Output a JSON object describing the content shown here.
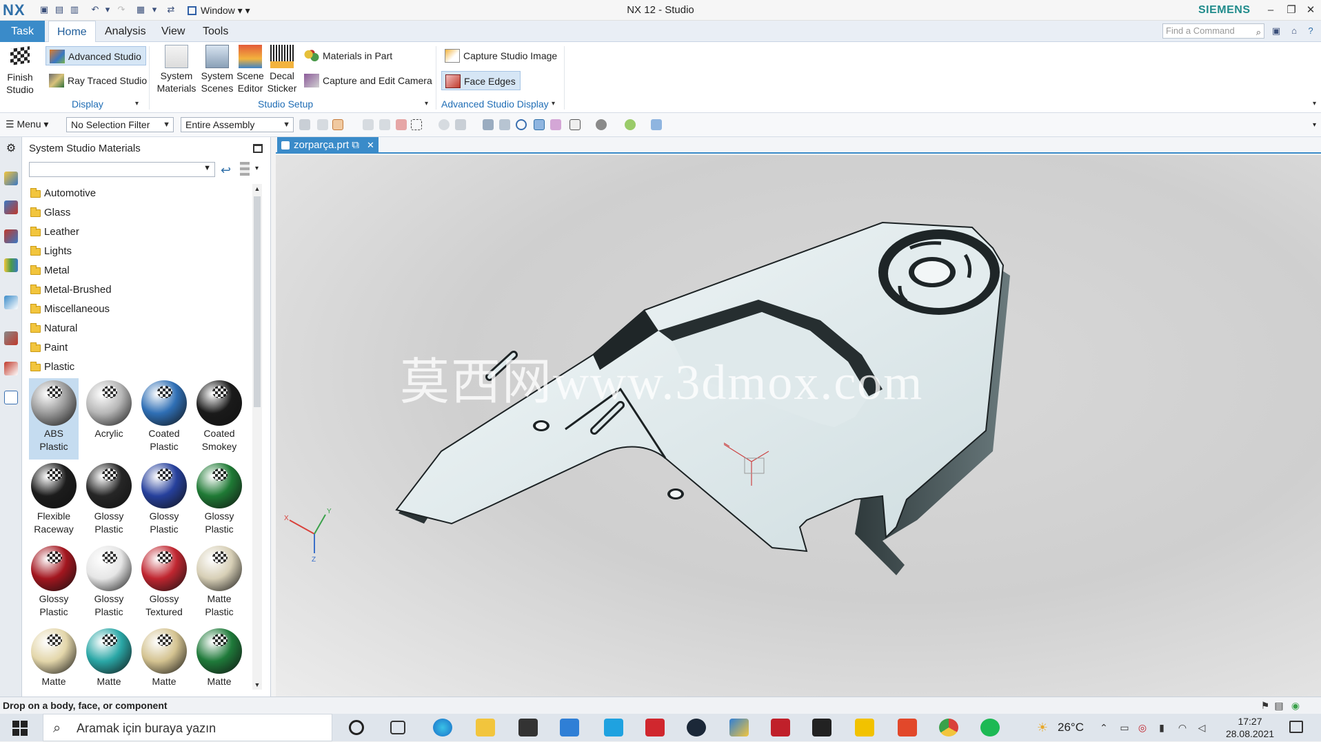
{
  "window": {
    "logo": "NX",
    "window_menu": "Window",
    "title": "NX 12 - Studio",
    "brand": "SIEMENS"
  },
  "tabs": {
    "task": "Task",
    "items": [
      "Home",
      "Analysis",
      "View",
      "Tools"
    ],
    "active": "Home",
    "find_placeholder": "Find a Command"
  },
  "ribbon": {
    "finish_studio": [
      "Finish",
      "Studio"
    ],
    "advanced_studio": "Advanced Studio",
    "ray_traced_studio": "Ray Traced Studio",
    "group_display": "Display",
    "system_materials": [
      "System",
      "Materials"
    ],
    "system_scenes": [
      "System",
      "Scenes"
    ],
    "scene_editor": [
      "Scene",
      "Editor"
    ],
    "decal_sticker": [
      "Decal",
      "Sticker"
    ],
    "materials_in_part": "Materials in Part",
    "capture_edit_camera": "Capture and Edit Camera",
    "group_studio_setup": "Studio Setup",
    "capture_studio_image": "Capture Studio Image",
    "face_edges": "Face Edges",
    "group_advanced_display": "Advanced Studio Display"
  },
  "toolbar2": {
    "menu": "Menu",
    "selection_filter": "No Selection Filter",
    "scope": "Entire Assembly"
  },
  "panel": {
    "title": "System Studio Materials",
    "folders": [
      "Automotive",
      "Glass",
      "Leather",
      "Lights",
      "Metal",
      "Metal-Brushed",
      "Miscellaneous",
      "Natural",
      "Paint",
      "Plastic"
    ],
    "materials": [
      {
        "line1": "ABS",
        "line2": "Plastic",
        "color": "#9a9a9a",
        "selected": true
      },
      {
        "line1": "Acrylic",
        "line2": "",
        "color": "#b7b7b7",
        "selected": false
      },
      {
        "line1": "Coated",
        "line2": "Plastic",
        "color": "#2f6fb5",
        "selected": false
      },
      {
        "line1": "Coated",
        "line2": "Smokey",
        "color": "#1a1a1a",
        "selected": false
      },
      {
        "line1": "Flexible",
        "line2": "Raceway",
        "color": "#1c1c1c",
        "selected": false
      },
      {
        "line1": "Glossy",
        "line2": "Plastic",
        "color": "#262626",
        "selected": false
      },
      {
        "line1": "Glossy",
        "line2": "Plastic",
        "color": "#26409c",
        "selected": false
      },
      {
        "line1": "Glossy",
        "line2": "Plastic",
        "color": "#1f7a35",
        "selected": false
      },
      {
        "line1": "Glossy",
        "line2": "Plastic",
        "color": "#a3161f",
        "selected": false
      },
      {
        "line1": "Glossy",
        "line2": "Plastic",
        "color": "#e6e6e6",
        "selected": false
      },
      {
        "line1": "Glossy",
        "line2": "Textured",
        "color": "#c02630",
        "selected": false
      },
      {
        "line1": "Matte",
        "line2": "Plastic",
        "color": "#d7cfb6",
        "selected": false
      },
      {
        "line1": "Matte",
        "line2": "",
        "color": "#e3d6aa",
        "selected": false
      },
      {
        "line1": "Matte",
        "line2": "",
        "color": "#2aa7a6",
        "selected": false
      },
      {
        "line1": "Matte",
        "line2": "",
        "color": "#d4c391",
        "selected": false
      },
      {
        "line1": "Matte",
        "line2": "",
        "color": "#1f7a3a",
        "selected": false
      }
    ]
  },
  "document": {
    "tab": "zorparça.prt",
    "watermark": "莫西网www.3dmox.com"
  },
  "status": {
    "message": "Drop on a body, face, or component"
  },
  "taskbar": {
    "search_placeholder": "Aramak için buraya yazın",
    "temperature": "26°C",
    "time": "17:27",
    "date": "28.08.2021"
  }
}
